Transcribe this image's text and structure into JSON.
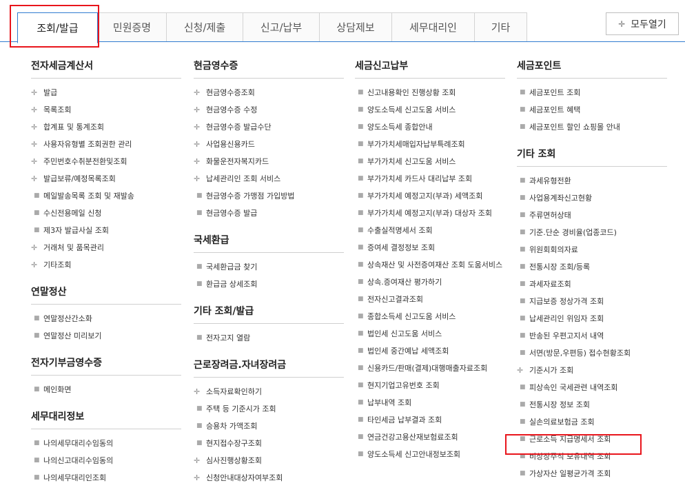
{
  "tabs": [
    {
      "label": "조회/발급",
      "active": true
    },
    {
      "label": "민원증명"
    },
    {
      "label": "신청/제출"
    },
    {
      "label": "신고/납부"
    },
    {
      "label": "상담제보"
    },
    {
      "label": "세무대리인"
    },
    {
      "label": "기타"
    }
  ],
  "expand_button": {
    "icon": "crosshair-icon",
    "label": "모두열기"
  },
  "col1": {
    "sections": [
      {
        "title": "전자세금계산서",
        "items": [
          {
            "label": "발급",
            "sub": true
          },
          {
            "label": "목록조회",
            "sub": true
          },
          {
            "label": "합계표 및 통계조회",
            "sub": true
          },
          {
            "label": "사용자유형별 조회권한 관리",
            "sub": true
          },
          {
            "label": "주민번호수취분전환및조회",
            "sub": true
          },
          {
            "label": "발급보류/예정목록조회",
            "sub": true
          },
          {
            "label": "메일발송목록 조회 및 재발송"
          },
          {
            "label": "수신전용메일 신청"
          },
          {
            "label": "제3자 발급사실 조회"
          },
          {
            "label": "거래처 및 품목관리",
            "sub": true
          },
          {
            "label": "기타조회",
            "sub": true
          }
        ]
      },
      {
        "title": "연말정산",
        "items": [
          {
            "label": "연말정산간소화"
          },
          {
            "label": "연말정산 미리보기"
          }
        ]
      },
      {
        "title": "전자기부금영수증",
        "items": [
          {
            "label": "메인화면"
          }
        ]
      },
      {
        "title": "세무대리정보",
        "items": [
          {
            "label": "나의세무대리수임동의"
          },
          {
            "label": "나의신고대리수임동의"
          },
          {
            "label": "나의세무대리인조회"
          }
        ]
      }
    ]
  },
  "col2": {
    "sections": [
      {
        "title": "현금영수증",
        "items": [
          {
            "label": "현금영수증조회",
            "sub": true
          },
          {
            "label": "현금영수증 수정",
            "sub": true
          },
          {
            "label": "현금영수증 발급수단",
            "sub": true
          },
          {
            "label": "사업용신용카드",
            "sub": true
          },
          {
            "label": "화물운전자복지카드",
            "sub": true
          },
          {
            "label": "납세관리인 조회 서비스",
            "sub": true
          },
          {
            "label": "현금영수증 가맹점 가입방법"
          },
          {
            "label": "현금영수증 발급"
          }
        ]
      },
      {
        "title": "국세환급",
        "items": [
          {
            "label": "국세환급금 찾기"
          },
          {
            "label": "환급금 상세조회"
          }
        ]
      },
      {
        "title": "기타 조회/발급",
        "items": [
          {
            "label": "전자고지 열람"
          }
        ]
      },
      {
        "title": "근로장려금.자녀장려금",
        "items": [
          {
            "label": "소득자료확인하기",
            "sub": true
          },
          {
            "label": "주택 등 기준시가 조회"
          },
          {
            "label": "승용차 가액조회"
          },
          {
            "label": "현지접수장구조회"
          },
          {
            "label": "심사진행상황조회",
            "sub": true
          },
          {
            "label": "신청안내대상자여부조회",
            "sub": true
          }
        ]
      }
    ]
  },
  "col3": {
    "sections": [
      {
        "title": "세금신고납부",
        "items": [
          {
            "label": "신고내용확인 진행상황 조회"
          },
          {
            "label": "양도소득세 신고도움 서비스"
          },
          {
            "label": "양도소득세 종합안내"
          },
          {
            "label": "부가가치세매입자납부특례조회"
          },
          {
            "label": "부가가치세 신고도움 서비스"
          },
          {
            "label": "부가가치세 카드사 대리납부 조회"
          },
          {
            "label": "부가가치세 예정고지(부과) 세액조회"
          },
          {
            "label": "부가가치세 예정고지(부과) 대상자 조회"
          },
          {
            "label": "수출실적명세서 조회"
          },
          {
            "label": "증여세 결정정보 조회"
          },
          {
            "label": "상속재산 및 사전증여재산 조회 도움서비스"
          },
          {
            "label": "상속.증여재산 평가하기"
          },
          {
            "label": "전자신고결과조회"
          },
          {
            "label": "종합소득세 신고도움 서비스"
          },
          {
            "label": "법인세 신고도움 서비스"
          },
          {
            "label": "법인세 중간예납 세액조회"
          },
          {
            "label": "신용카드/판매(결제)대행매출자료조회"
          },
          {
            "label": "현지기업고유번호 조회"
          },
          {
            "label": "납부내역 조회"
          },
          {
            "label": "타인세금 납부결과 조회"
          },
          {
            "label": "연금건강고용산재보험료조회"
          },
          {
            "label": "양도소득세 신고안내정보조회"
          }
        ]
      }
    ]
  },
  "col4": {
    "sections": [
      {
        "title": "세금포인트",
        "items": [
          {
            "label": "세금포인트 조회"
          },
          {
            "label": "세금포인트 혜택"
          },
          {
            "label": "세금포인트 할인 쇼핑몰 안내"
          }
        ]
      },
      {
        "title": "기타 조회",
        "items": [
          {
            "label": "과세유형전환"
          },
          {
            "label": "사업용계좌신고현황"
          },
          {
            "label": "주류면허상태"
          },
          {
            "label": "기준.단순 경비율(업종코드)"
          },
          {
            "label": "위원회회의자료"
          },
          {
            "label": "전통시장 조회/등록"
          },
          {
            "label": "과세자료조회"
          },
          {
            "label": "지급보증 정상가격 조회"
          },
          {
            "label": "납세관리인 위임자 조회"
          },
          {
            "label": "반송된 우편고지서 내역"
          },
          {
            "label": "서면(방문,우편등) 접수현황조회"
          },
          {
            "label": "기준시가 조회",
            "sub": true
          },
          {
            "label": "피상속인 국세관련 내역조회"
          },
          {
            "label": "전통시장 정보 조회"
          },
          {
            "label": "실손의료보험금 조회"
          },
          {
            "label": "근로소득 지급명세서 조회"
          },
          {
            "label": "비상장주식 보유내역 조회"
          },
          {
            "label": "가상자산 일평균가격 조회"
          }
        ]
      }
    ]
  }
}
